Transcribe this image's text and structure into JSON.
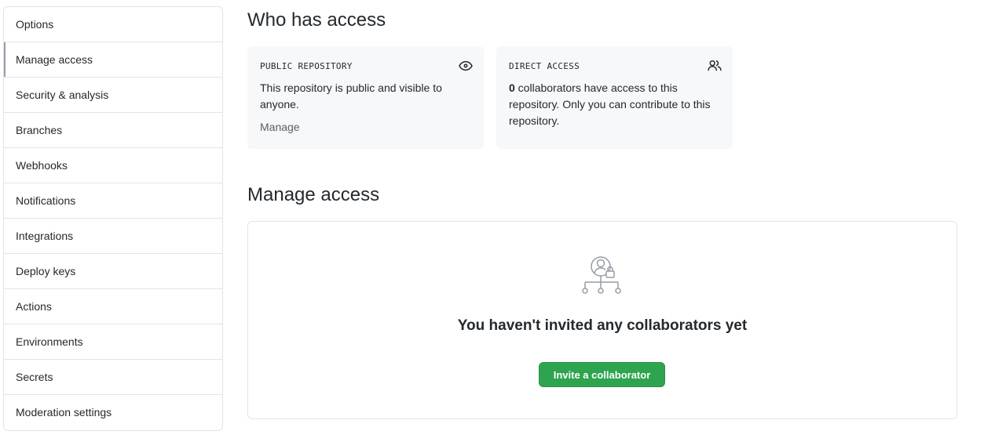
{
  "sidebar": {
    "items": [
      {
        "label": "Options",
        "active": false
      },
      {
        "label": "Manage access",
        "active": true
      },
      {
        "label": "Security & analysis",
        "active": false
      },
      {
        "label": "Branches",
        "active": false
      },
      {
        "label": "Webhooks",
        "active": false
      },
      {
        "label": "Notifications",
        "active": false
      },
      {
        "label": "Integrations",
        "active": false
      },
      {
        "label": "Deploy keys",
        "active": false
      },
      {
        "label": "Actions",
        "active": false
      },
      {
        "label": "Environments",
        "active": false
      },
      {
        "label": "Secrets",
        "active": false
      },
      {
        "label": "Moderation settings",
        "active": false
      }
    ]
  },
  "who_has_access": {
    "title": "Who has access",
    "public_card": {
      "label": "PUBLIC REPOSITORY",
      "icon": "eye-icon",
      "text": "This repository is public and visible to anyone.",
      "link": "Manage"
    },
    "direct_card": {
      "label": "DIRECT ACCESS",
      "icon": "people-icon",
      "count": "0",
      "text": " collaborators have access to this repository. Only you can contribute to this repository."
    }
  },
  "manage_access": {
    "title": "Manage access",
    "empty_icon": "collaborators-lock-icon",
    "empty_heading": "You haven't invited any collaborators yet",
    "invite_button": "Invite a collaborator"
  },
  "colors": {
    "accent_green": "#2ea44f",
    "card_background": "#f6f8fa",
    "border": "#e1e4e8",
    "muted_text": "#586069"
  }
}
